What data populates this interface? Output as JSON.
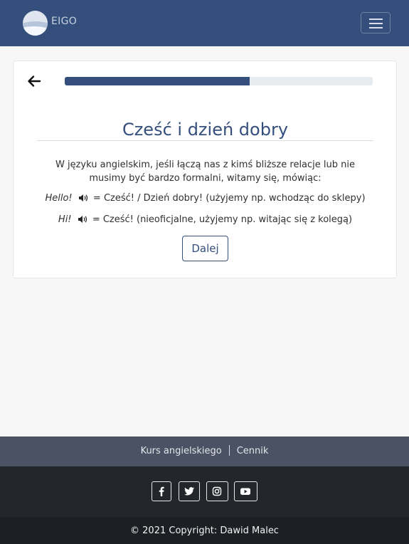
{
  "navbar": {
    "brand": "EIGO",
    "menu_icon": "hamburger-menu-icon"
  },
  "lesson": {
    "back_icon": "arrow-left-icon",
    "progress_fraction": 0.6,
    "title": "Cześć i dzień dobry",
    "intro": "W języku angielskim, jeśli łączą nas z kimś bliższe relacje lub nie musimy być bardzo formalni, witamy się, mówiąc:",
    "phrases": [
      {
        "english": "Hello!",
        "translation": "= Cześć! / Dzień dobry! (użyjemy np. wchodząc do sklepy)",
        "audio_icon": "speaker-icon"
      },
      {
        "english": "Hi!",
        "translation": "= Cześć! (nieoficjalne, użyjemy np. witając się z kolegą)",
        "audio_icon": "speaker-icon"
      }
    ],
    "next_label": "Dalej"
  },
  "footer": {
    "links": [
      "Kurs angielskiego",
      "Cennik"
    ],
    "social_icons": [
      "facebook-icon",
      "twitter-icon",
      "instagram-icon",
      "youtube-icon"
    ],
    "copyright": "© 2021 Copyright: Dawid Malec"
  },
  "colors": {
    "brand": "#344f7c",
    "footer_links_bg": "#4a5263",
    "footer_social_bg": "#23272b",
    "footer_copy_bg": "#1c1f23"
  }
}
